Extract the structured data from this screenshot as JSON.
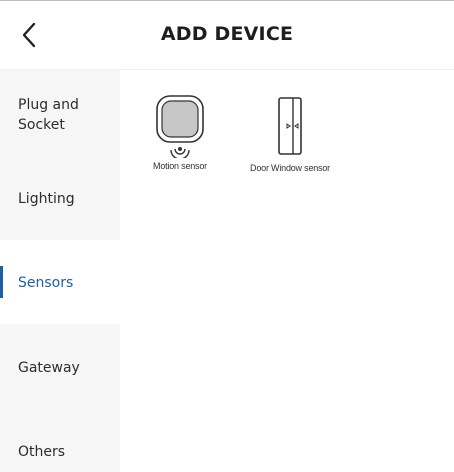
{
  "header": {
    "title": "ADD DEVICE",
    "back_icon": "chevron-left-icon"
  },
  "sidebar": {
    "items": [
      {
        "label": "Plug and\nSocket",
        "active": false
      },
      {
        "label": "Lighting",
        "active": false
      },
      {
        "label": "Sensors",
        "active": true
      },
      {
        "label": "Gateway",
        "active": false
      },
      {
        "label": "Others",
        "active": false
      }
    ]
  },
  "devices": [
    {
      "label": "Motion sensor",
      "icon": "motion-sensor-icon"
    },
    {
      "label": "Door Window sensor",
      "icon": "door-window-sensor-icon"
    }
  ],
  "colors": {
    "accent": "#1f5fa3",
    "sidebar_bg": "#f6f6f6"
  }
}
